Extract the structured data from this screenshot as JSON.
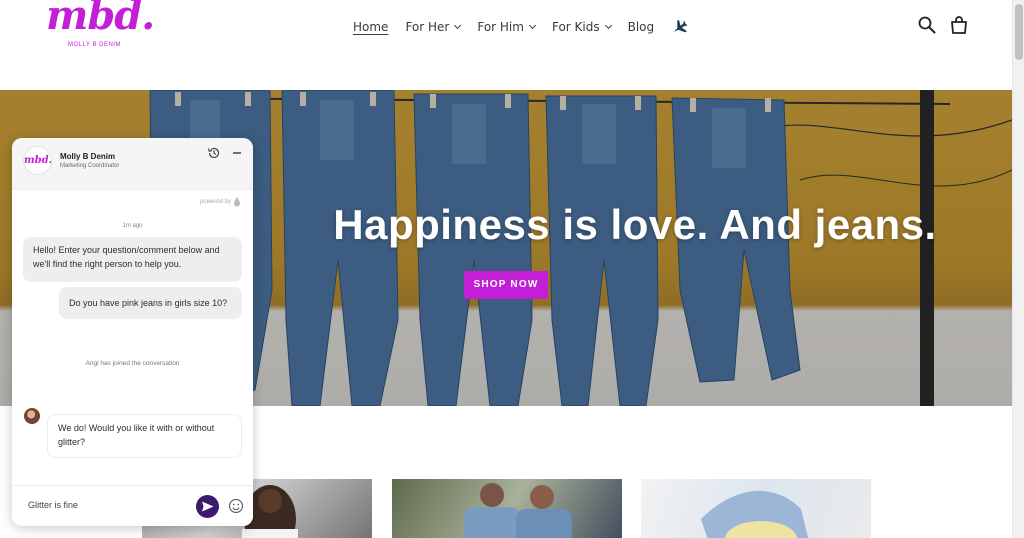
{
  "brand": {
    "logo_text": "mbd.",
    "logo_subtitle": "MOLLY B DENIM",
    "accent_color": "#c21fd6"
  },
  "nav": {
    "home": "Home",
    "for_her": "For Her",
    "for_him": "For Him",
    "for_kids": "For Kids",
    "blog": "Blog",
    "extra_icon": "airplane-icon"
  },
  "header_icons": [
    "search-icon",
    "cart-icon"
  ],
  "hero": {
    "title": "Happiness is love. And jeans.",
    "button_label": "SHOP NOW",
    "button_color": "#c21fd6"
  },
  "chat": {
    "avatar_text": "mbd.",
    "agent_name": "Molly B Denim",
    "agent_role": "Marketing Coordinator",
    "powered_label": "powered by",
    "timestamp": "1m ago",
    "messages": [
      {
        "from": "agent",
        "text": "Hello! Enter your question/comment below and we'll find the right person to help you."
      },
      {
        "from": "user",
        "text": "Do you have pink jeans in girls size 10?"
      },
      {
        "from": "system",
        "text": "Angi has joined the conversation"
      },
      {
        "from": "agent",
        "text": "We do! Would you like it with or without glitter?"
      }
    ],
    "input_value": "Glitter is fine",
    "send_color": "#3e1a6e"
  }
}
